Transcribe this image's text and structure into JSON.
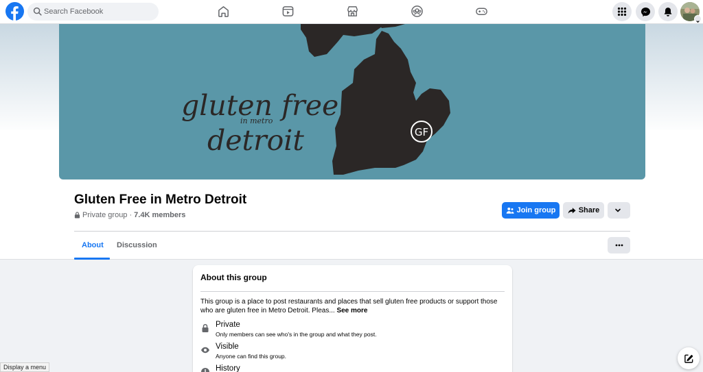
{
  "search": {
    "placeholder": "Search Facebook"
  },
  "nav": {
    "icons": [
      "home-icon",
      "video-icon",
      "marketplace-icon",
      "groups-icon",
      "gaming-icon"
    ]
  },
  "top_right": {
    "icons": [
      "menu-grid-icon",
      "messenger-icon",
      "notifications-bell-icon",
      "account-avatar"
    ]
  },
  "cover": {
    "line1": "gluten free",
    "line2": "in metro",
    "line3": "detroit",
    "badge": "GF",
    "background_color": "#5a97a8",
    "map_color": "#2b2726"
  },
  "group": {
    "title": "Gluten Free in Metro Detroit",
    "privacy": "Private group",
    "separator": "·",
    "members": "7.4K members"
  },
  "actions": {
    "join": "Join group",
    "share": "Share"
  },
  "tabs": [
    {
      "label": "About",
      "active": true
    },
    {
      "label": "Discussion",
      "active": false
    }
  ],
  "about": {
    "title": "About this group",
    "description": "This group is a place to post restaurants and places that sell gluten free products or support those who are gluten free in Metro Detroit. Pleas...",
    "see_more": "See more",
    "features": [
      {
        "icon": "lock-icon",
        "title": "Private",
        "subtitle": "Only members can see who's in the group and what they post."
      },
      {
        "icon": "eye-icon",
        "title": "Visible",
        "subtitle": "Anyone can find this group."
      },
      {
        "icon": "clock-icon",
        "title": "History",
        "subtitle": ""
      }
    ]
  },
  "status_bar": {
    "text": "Display a menu"
  },
  "colors": {
    "accent": "#1877f2",
    "background": "#f0f2f5"
  }
}
